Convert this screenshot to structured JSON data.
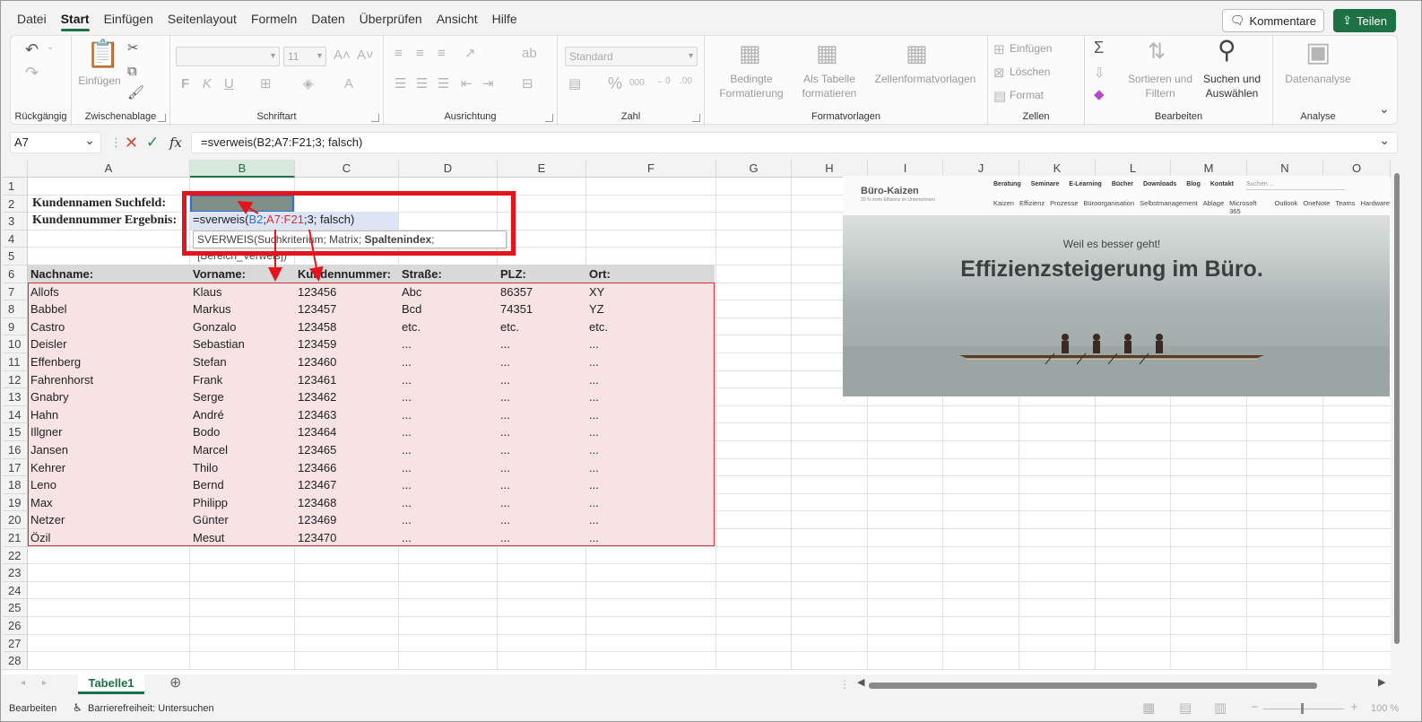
{
  "menu": [
    "Datei",
    "Start",
    "Einfügen",
    "Seitenlayout",
    "Formeln",
    "Daten",
    "Überprüfen",
    "Ansicht",
    "Hilfe"
  ],
  "header_buttons": {
    "comments": "Kommentare",
    "share": "Teilen"
  },
  "ribbon": {
    "groups": {
      "undo": "Rückgängig",
      "clipboard": "Zwischenablage",
      "font": "Schriftart",
      "alignment": "Ausrichtung",
      "number": "Zahl",
      "styles": "Formatvorlagen",
      "cells": "Zellen",
      "editing": "Bearbeiten",
      "analysis": "Analyse"
    },
    "paste_label": "Einfügen",
    "font_size": "11",
    "number_format": "Standard",
    "conditional_format": "Bedingte Formatierung",
    "as_table": "Als Tabelle formatieren",
    "cell_styles": "Zellenformatvorlagen",
    "insert": "Einfügen",
    "delete": "Löschen",
    "format": "Format",
    "sort_filter": "Sortieren und Filtern",
    "find_select": "Suchen und Auswählen",
    "data_analysis": "Datenanalyse"
  },
  "formula_bar": {
    "namebox": "A7",
    "fx": "fx",
    "formula": "=sverweis(B2;A7:F21;3; falsch)"
  },
  "columns": [
    "A",
    "B",
    "C",
    "D",
    "E",
    "F",
    "G",
    "H",
    "I",
    "J",
    "K",
    "L",
    "M",
    "N",
    "O"
  ],
  "selected_column": "B",
  "labels": {
    "search_field": "Kundennamen Suchfeld:",
    "result": "Kundennummer Ergebnis:"
  },
  "edit_formula": {
    "prefix": "=sverweis(",
    "ref1": "B2",
    "sep1": ";",
    "ref2": "A7:F21",
    "rest": ";3; falsch)",
    "ref1_color": "#2f6fd1",
    "ref2_color": "#c8363c"
  },
  "tooltip": {
    "func": "SVERWEIS(Suchkriterium; Matrix; ",
    "bold_arg": "Spaltenindex",
    "rest": "; [Bereich_Verweis])"
  },
  "table": {
    "headers": [
      "Nachname:",
      "Vorname:",
      "Kundennummer:",
      "Straße:",
      "PLZ:",
      "Ort:"
    ],
    "rows": [
      [
        "Allofs",
        "Klaus",
        "123456",
        "Abc",
        "86357",
        "XY"
      ],
      [
        "Babbel",
        "Markus",
        "123457",
        "Bcd",
        "74351",
        "YZ"
      ],
      [
        "Castro",
        "Gonzalo",
        "123458",
        "etc.",
        "etc.",
        "etc."
      ],
      [
        "Deisler",
        "Sebastian",
        "123459",
        "...",
        "...",
        "..."
      ],
      [
        "Effenberg",
        "Stefan",
        "123460",
        "...",
        "...",
        "..."
      ],
      [
        "Fahrenhorst",
        "Frank",
        "123461",
        "...",
        "...",
        "..."
      ],
      [
        "Gnabry",
        "Serge",
        "123462",
        "...",
        "...",
        "..."
      ],
      [
        "Hahn",
        "André",
        "123463",
        "...",
        "...",
        "..."
      ],
      [
        "Illgner",
        "Bodo",
        "123464",
        "...",
        "...",
        "..."
      ],
      [
        "Jansen",
        "Marcel",
        "123465",
        "...",
        "...",
        "..."
      ],
      [
        "Kehrer",
        "Thilo",
        "123466",
        "...",
        "...",
        "..."
      ],
      [
        "Leno",
        "Bernd",
        "123467",
        "...",
        "...",
        "..."
      ],
      [
        "Max",
        "Philipp",
        "123468",
        "...",
        "...",
        "..."
      ],
      [
        "Netzer",
        "Günter",
        "123469",
        "...",
        "...",
        "..."
      ],
      [
        "Özil",
        "Mesut",
        "123470",
        "...",
        "...",
        "..."
      ]
    ]
  },
  "banner": {
    "logo": "Büro-Kaizen",
    "logo_sub": "20 % mehr Effizienz im Unternehmen",
    "nav": [
      "Beratung",
      "Seminare",
      "E-Learning",
      "Bücher",
      "Downloads",
      "Blog",
      "Kontakt"
    ],
    "search": "Suchen ...",
    "categories": [
      "Kaizen",
      "Effizienz",
      "Prozesse",
      "Büroorganisation",
      "Selbstmanagement",
      "Ablage",
      "Microsoft 365",
      "Outlook",
      "OneNote",
      "Teams",
      "Hardware"
    ],
    "slogan": "Weil es besser geht!",
    "headline": "Effizienzsteigerung im Büro."
  },
  "sheet_tab": "Tabelle1",
  "status": {
    "mode": "Bearbeiten",
    "accessibility": "Barrierefreiheit: Untersuchen",
    "zoom": "100 %"
  },
  "colors": {
    "accent": "#1e7145",
    "highlight_red": "#e3141b",
    "table_fill": "#f8e3e4"
  }
}
